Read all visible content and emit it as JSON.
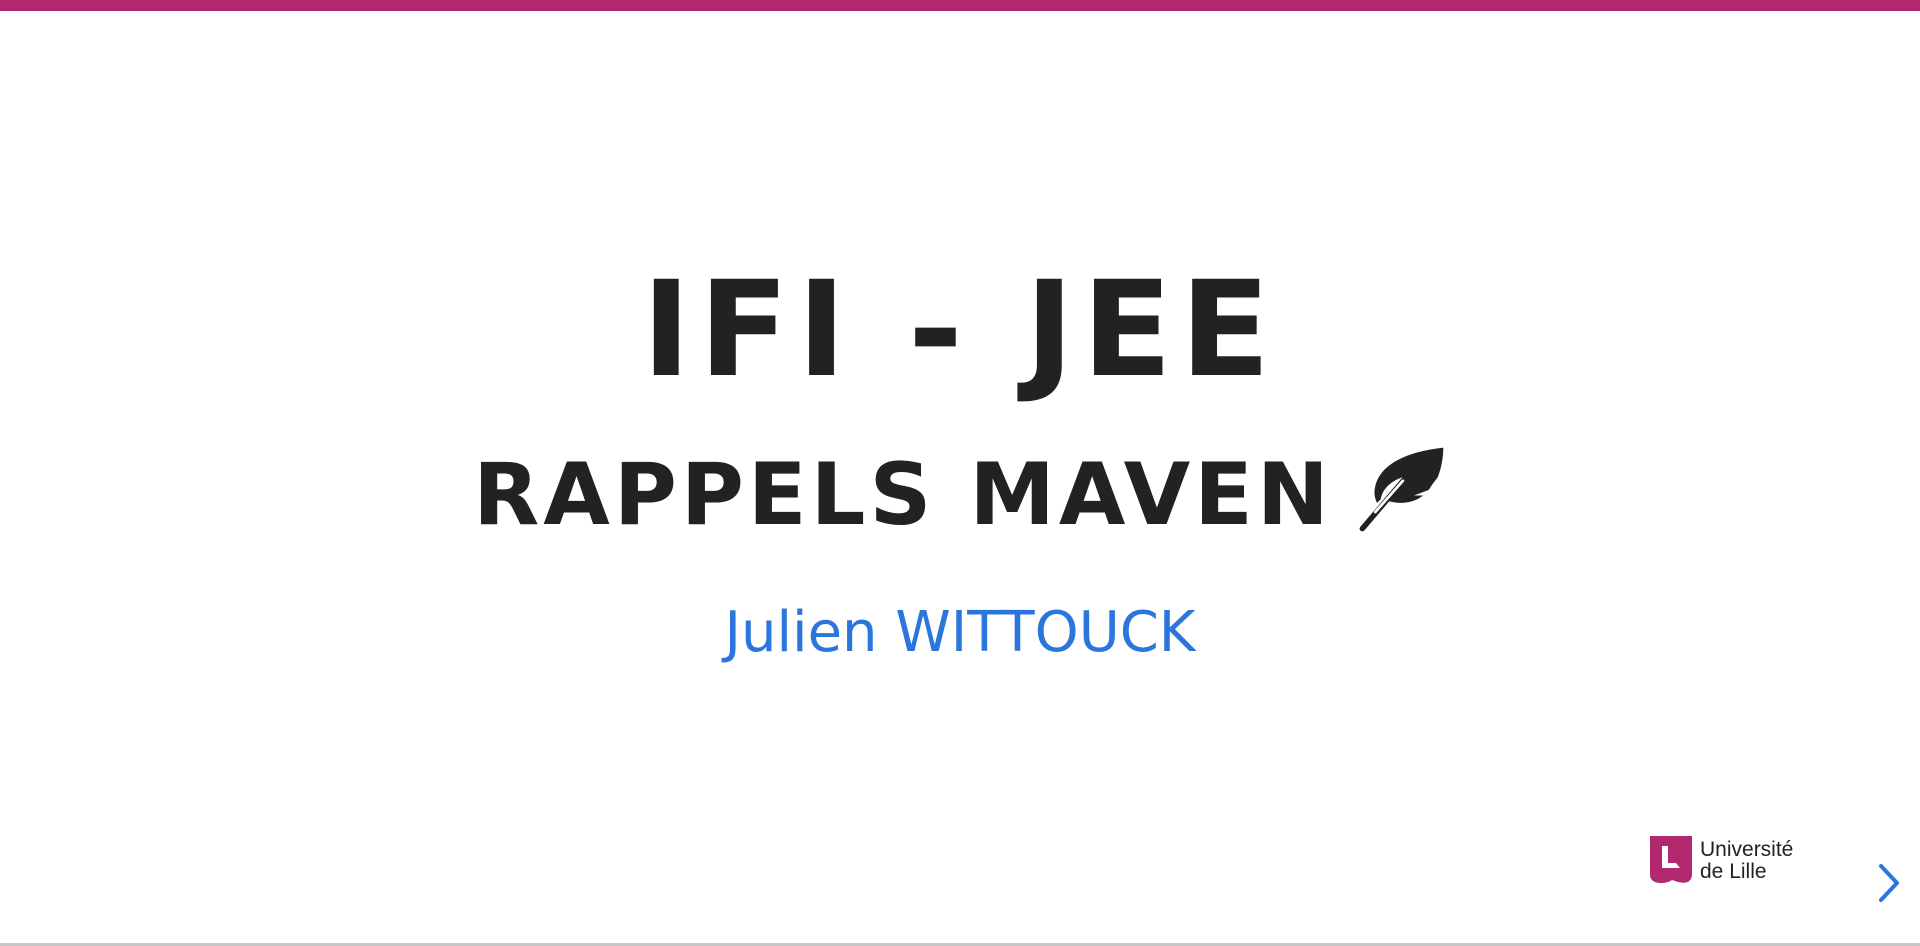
{
  "slide": {
    "title": "IFI - JEE",
    "subtitle": "RAPPELS MAVEN",
    "subtitle_icon": "feather-icon",
    "author": "Julien WITTOUCK"
  },
  "logo": {
    "line1": "Université",
    "line2": "de Lille",
    "icon": "universite-de-lille-logo"
  },
  "controls": {
    "next_icon": "chevron-right-icon"
  },
  "colors": {
    "accent_bar": "#b0286e",
    "title_text": "#222222",
    "author_text": "#2a76dd",
    "logo_mark": "#b0286e",
    "control_arrow": "#2a76dd"
  }
}
